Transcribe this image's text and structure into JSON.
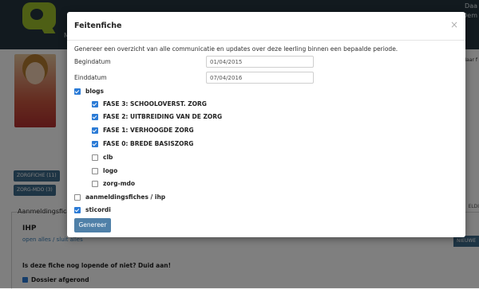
{
  "topbar": {
    "m_text": "M",
    "right_line1": "Daa",
    "right_line2": "Dem"
  },
  "background": {
    "btn_zorgfiche": "ZORGFICHE (11)",
    "btn_zorgmdo": "ZORG-MDO (3)",
    "section_title": "Aanmeldingsfiche",
    "ihp": "IHP",
    "links": "open alles / sluit alles",
    "question": "Is deze fiche nog lopende of niet? Duid aan!",
    "dossier": "Dossier afgerond",
    "right_top": "Naar f",
    "right_mid": "ELDI",
    "nieuwe": "NIEUWE"
  },
  "modal": {
    "title": "Feitenfiche",
    "close": "×",
    "description": "Genereer een overzicht van alle communicatie en updates over deze leerling binnen een bepaalde periode.",
    "begindatum_label": "Begindatum",
    "begindatum_value": "01/04/2015",
    "einddatum_label": "Einddatum",
    "einddatum_value": "07/04/2016",
    "checkboxes": [
      {
        "label": "blogs",
        "checked": true
      },
      {
        "label": "FASE 3: SCHOOLOVERST. ZORG",
        "checked": true
      },
      {
        "label": "FASE 2: UITBREIDING VAN DE ZORG",
        "checked": true
      },
      {
        "label": "FASE 1: VERHOOGDE ZORG",
        "checked": true
      },
      {
        "label": "FASE 0: BREDE BASISZORG",
        "checked": true
      },
      {
        "label": "clb",
        "checked": false
      },
      {
        "label": "logo",
        "checked": false
      },
      {
        "label": "zorg-mdo",
        "checked": false
      },
      {
        "label": "aanmeldingsfiches / ihp",
        "checked": false
      },
      {
        "label": "sticordi",
        "checked": true
      }
    ],
    "generate_label": "Genereer"
  }
}
